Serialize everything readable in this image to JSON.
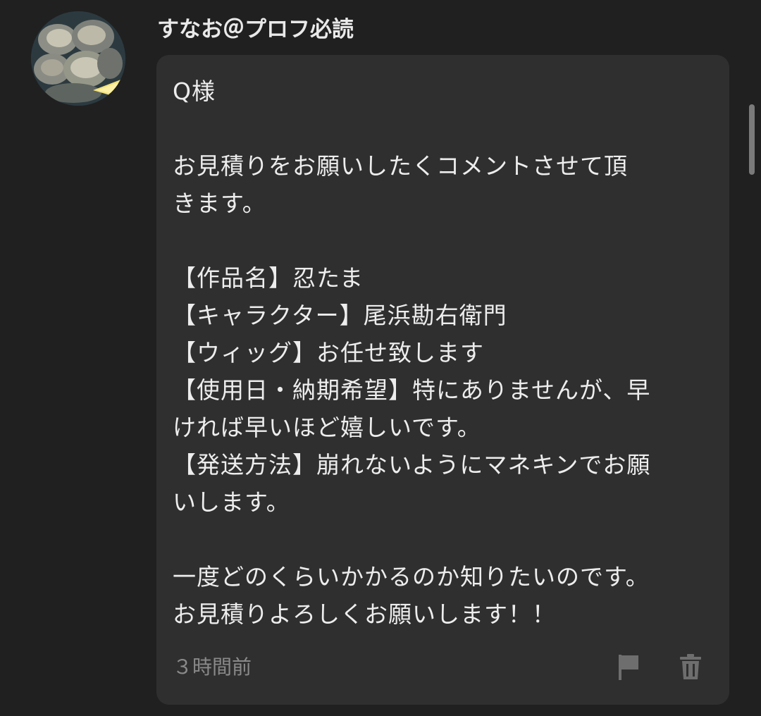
{
  "comment": {
    "author": "すなお＠プロフ必読",
    "lines": [
      "Q様",
      "",
      "お見積りをお願いしたくコメントさせて頂",
      "きます。",
      "",
      "【作品名】忍たま",
      "【キャラクター】尾浜勘右衛門",
      "【ウィッグ】お任せ致します",
      "【使用日・納期希望】特にありませんが、早",
      "ければ早いほど嬉しいです。",
      "【発送方法】崩れないようにマネキンでお願",
      "いします。",
      "",
      "一度どのくらいかかるのか知りたいのです。",
      "お見積りよろしくお願いします！！"
    ],
    "timestamp": "３時間前"
  },
  "icons": {
    "avatar": "oyster-avatar",
    "report": "flag-icon",
    "delete": "trash-icon"
  },
  "colors": {
    "background": "#202020",
    "bubble": "#2f2f2f",
    "text": "#ededed",
    "muted": "#8a8a8a",
    "icon": "#6e6e6e"
  }
}
